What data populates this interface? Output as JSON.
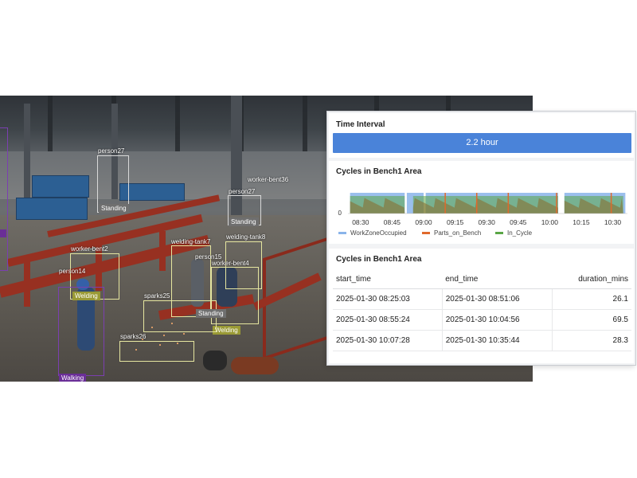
{
  "video": {
    "detections": [
      {
        "label": "person27",
        "tag": "Standing"
      },
      {
        "label": "person27",
        "tag": "Standing"
      },
      {
        "label": "worker-bent36",
        "tag": ""
      },
      {
        "label": "worker-bent2",
        "tag": "Welding"
      },
      {
        "label": "person14",
        "tag": ""
      },
      {
        "label": "welding-tank7",
        "tag": ""
      },
      {
        "label": "welding-tank8",
        "tag": ""
      },
      {
        "label": "person15",
        "tag": ""
      },
      {
        "label": "worker-bent4",
        "tag": "Welding"
      },
      {
        "label": "sparks25",
        "tag": "Standing"
      },
      {
        "label": "sparks26",
        "tag": ""
      },
      {
        "label": "",
        "tag": "Walking"
      }
    ]
  },
  "dashboard": {
    "interval": {
      "title": "Time Interval",
      "value": "2.2 hour"
    },
    "chart_title": "Cycles in Bench1 Area",
    "table_title": "Cycles in Bench1 Area",
    "legend": [
      {
        "name": "WorkZoneOccupied",
        "color": "#8ab4ea"
      },
      {
        "name": "Parts_on_Bench",
        "color": "#e0692c"
      },
      {
        "name": "In_Cycle",
        "color": "#5aa646"
      }
    ],
    "table": {
      "columns": [
        "start_time",
        "end_time",
        "duration_mins"
      ],
      "rows": [
        [
          "2025-01-30 08:25:03",
          "2025-01-30 08:51:06",
          "26.1"
        ],
        [
          "2025-01-30 08:55:24",
          "2025-01-30 10:04:56",
          "69.5"
        ],
        [
          "2025-01-30 10:07:28",
          "2025-01-30 10:35:44",
          "28.3"
        ]
      ]
    }
  },
  "chart_data": {
    "type": "area",
    "title": "Cycles in Bench1 Area",
    "x_ticks": [
      "08:30",
      "08:45",
      "09:00",
      "09:15",
      "09:30",
      "09:45",
      "10:00",
      "10:15",
      "10:30"
    ],
    "y_ticks": [
      "0"
    ],
    "series": [
      {
        "name": "WorkZoneOccupied",
        "color": "#8ab4ea",
        "segments": [
          [
            "08:25",
            "08:51"
          ],
          [
            "08:52",
            "09:00"
          ],
          [
            "09:01",
            "10:04"
          ],
          [
            "10:07",
            "10:36"
          ]
        ]
      },
      {
        "name": "Parts_on_Bench",
        "color": "#e0692c",
        "segments": [
          [
            "09:10",
            "09:11"
          ],
          [
            "09:25",
            "09:26"
          ],
          [
            "09:40",
            "09:41"
          ],
          [
            "10:03",
            "10:04"
          ],
          [
            "10:29",
            "10:30"
          ]
        ]
      },
      {
        "name": "In_Cycle",
        "color": "#5aa646",
        "segments": [
          [
            "08:25",
            "08:51"
          ],
          [
            "08:55",
            "10:04"
          ],
          [
            "10:07",
            "10:35"
          ]
        ]
      }
    ],
    "xlim": [
      "08:24",
      "10:37"
    ]
  }
}
